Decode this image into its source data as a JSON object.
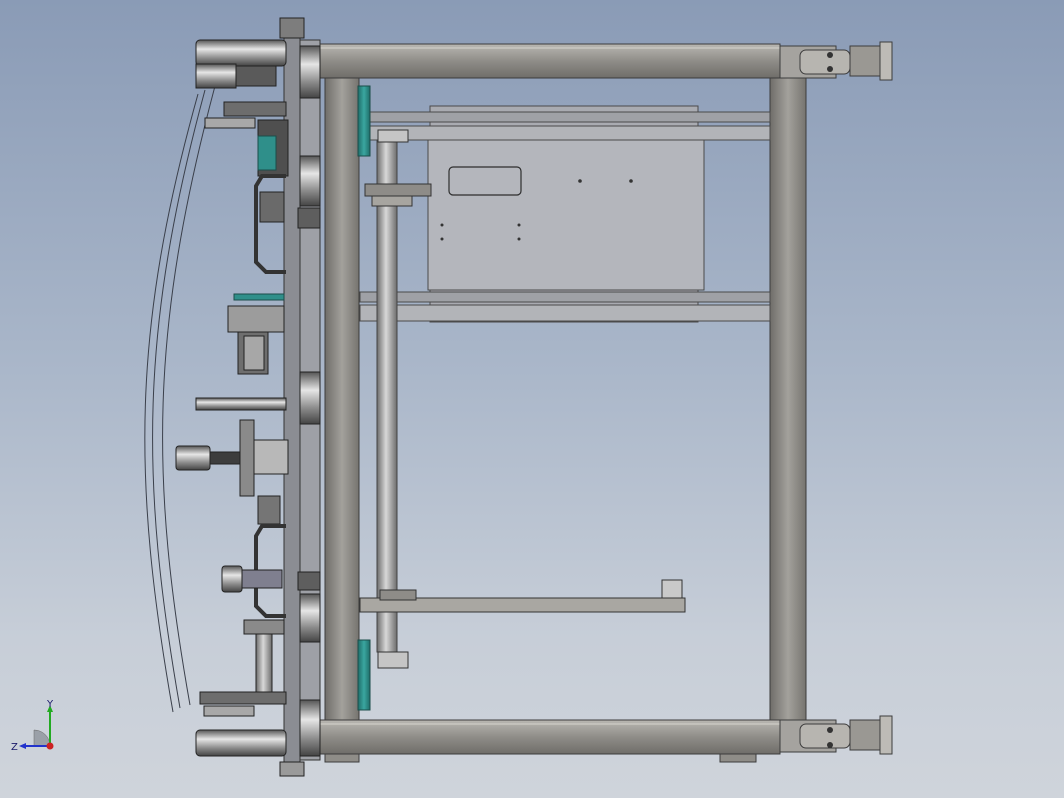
{
  "view": {
    "background_top": "#8a9bb6",
    "background_bottom": "#cfd4db",
    "frame_color": "#8c8a86",
    "teal_accent": "#2f8f8a"
  },
  "triad": {
    "x_label": "",
    "y_label": "Y",
    "z_label": "Z",
    "x_color": "#cc2222",
    "y_color": "#22aa22",
    "z_color": "#2233cc"
  }
}
